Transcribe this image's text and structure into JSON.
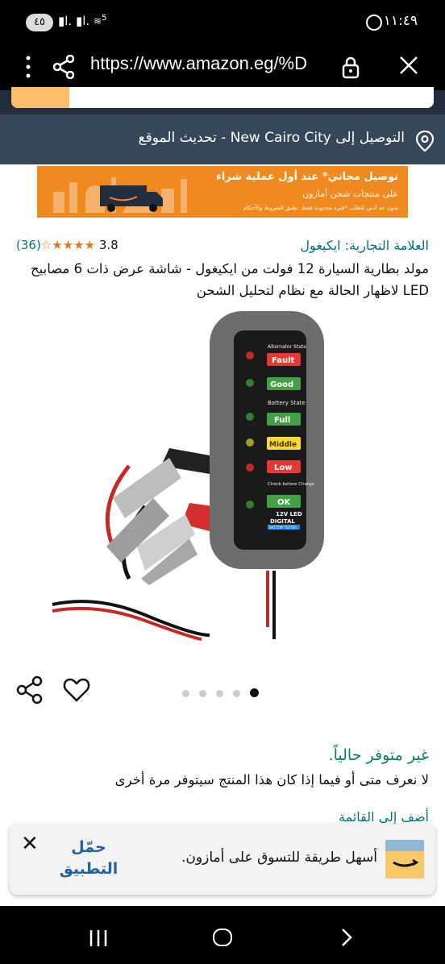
{
  "status_bar": {
    "time": "١١:٤٩",
    "battery": "٤٥",
    "network": "5"
  },
  "browser": {
    "url": "https://www.amazon.eg/%D"
  },
  "delivery": {
    "text": "التوصيل إلى New Cairo City - تحديث الموقع"
  },
  "promo_banner": {
    "line1": "توصيل مجاني* عند أول عملية شراء",
    "line2": "على منتجات شحن أمازون",
    "line3": "بدون حد أدنى للطلب *فترة محدودة فقط. تطبق الشروط والأحكام"
  },
  "product": {
    "brand": "العلامة التجارية: ايكيغول",
    "rating": "3.8",
    "rating_count": "(36)",
    "title": "مولد بطارية السيارة 12 فولت من ايكيغول - شاشة عرض ذات 6 مصابيح LED لاظهار الحالة مع نظام لتحليل الشحن",
    "device_labels": {
      "alternator": "Alternator State",
      "fault": "Fault",
      "good": "Good",
      "battery_state": "Battery State",
      "full": "Full",
      "middle": "Middle",
      "low": "Low",
      "check": "Check before Charge",
      "ok": "OK",
      "model": "12V LED",
      "digital": "DIGITAL",
      "tester": "BATTERY TESTER"
    },
    "carousel": {
      "total": 5,
      "active": 5
    }
  },
  "availability": {
    "status": "غير متوفر حالياً.",
    "note": "لا نعرف متى أو فيما إذا كان هذا المنتج سيتوفر مرة أخرى"
  },
  "add_to_list": "أضف إلى القائمة",
  "app_banner": {
    "cta": "حمّل التطبيق",
    "message": "أسهل طريقة للتسوق على أمازون."
  },
  "colors": {
    "amazon_navy": "#232f3e",
    "delivery_bar": "#37475a",
    "link": "#007185",
    "available_green": "#067d62",
    "star": "#de7921",
    "promo_orange": "#f0891f"
  }
}
